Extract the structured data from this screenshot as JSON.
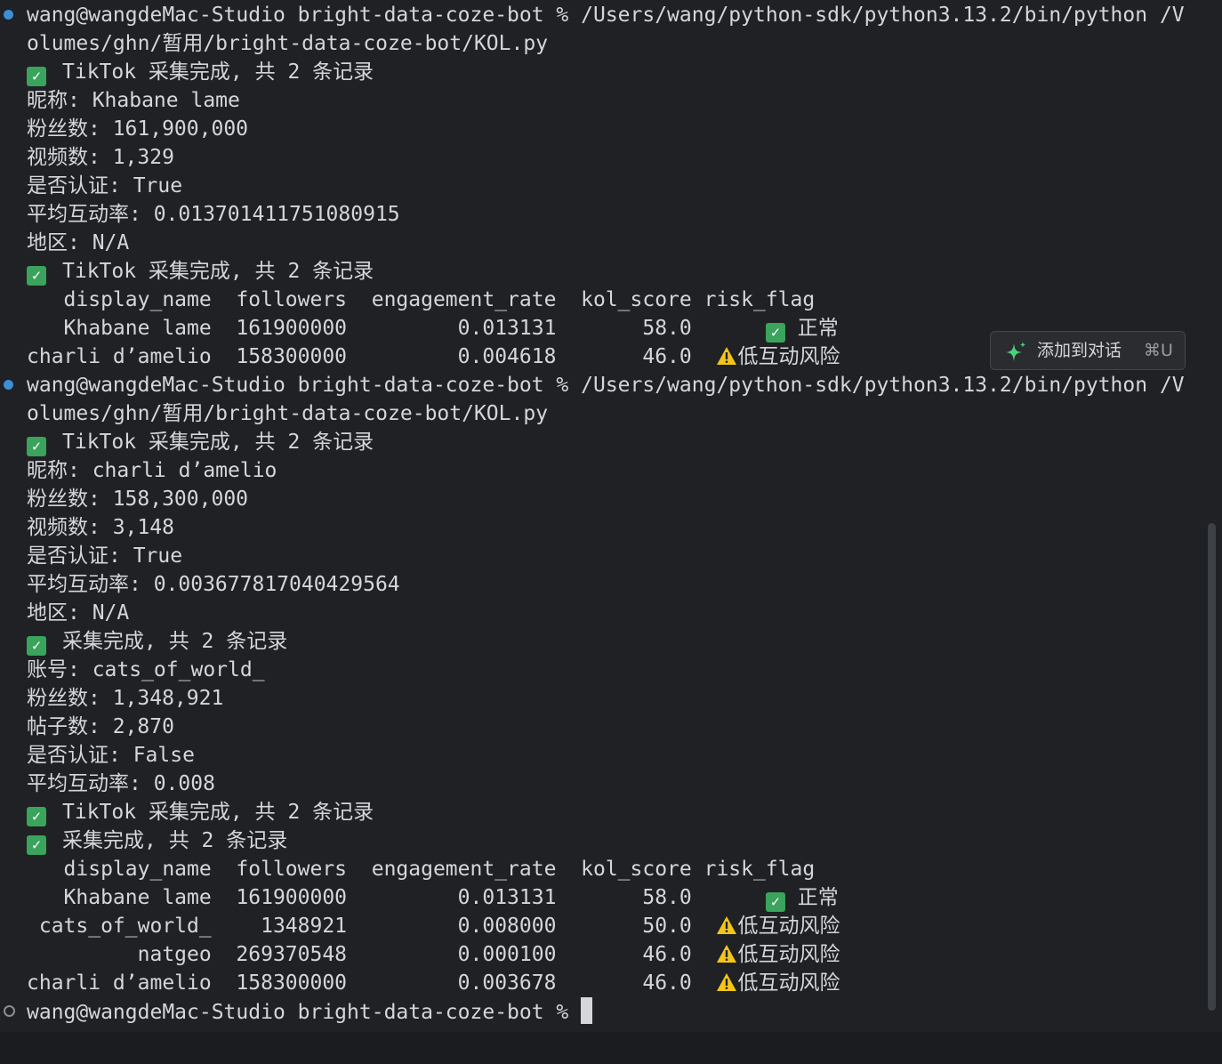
{
  "terminal": {
    "prompt": "wang@wangdeMac-Studio bright-data-coze-bot %",
    "command_part1": " /Users/wang/python-sdk/python3.13.2/bin/python /V",
    "command_part2": "olumes/ghn/暂用/bright-data-coze-bot/KOL.py",
    "tiktok_done": "TikTok 采集完成, 共 2 条记录",
    "ig_done": "采集完成, 共 2 条记录",
    "run1": {
      "nickname": "昵称: Khabane lame",
      "followers": "粉丝数: 161,900,000",
      "videos": "视频数: 1,329",
      "verified": "是否认证: True",
      "engagement": "平均互动率: 0.013701411751080915",
      "region": "地区: N/A",
      "table_header": "   display_name  followers  engagement_rate  kol_score risk_flag",
      "rows": [
        {
          "text": "   Khabane lame  161900000         0.013131       58.0      ",
          "flag_icon": "check",
          "flag": " 正常"
        },
        {
          "text": "charli d’amelio  158300000         0.004618       46.0  ",
          "flag_icon": "warning",
          "flag": "低互动风险"
        }
      ]
    },
    "run2": {
      "nickname": "昵称: charli d’amelio",
      "followers": "粉丝数: 158,300,000",
      "videos": "视频数: 3,148",
      "verified": "是否认证: True",
      "engagement": "平均互动率: 0.003677817040429564",
      "region": "地区: N/A",
      "ig_account": "账号: cats_of_world_",
      "ig_followers": "粉丝数: 1,348,921",
      "ig_posts": "帖子数: 2,870",
      "ig_verified": "是否认证: False",
      "ig_engagement": "平均互动率: 0.008",
      "table_header": "   display_name  followers  engagement_rate  kol_score risk_flag",
      "rows": [
        {
          "text": "   Khabane lame  161900000         0.013131       58.0      ",
          "flag_icon": "check",
          "flag": " 正常"
        },
        {
          "text": " cats_of_world_    1348921         0.008000       50.0  ",
          "flag_icon": "warning",
          "flag": "低互动风险"
        },
        {
          "text": "         natgeo  269370548         0.000100       46.0  ",
          "flag_icon": "warning",
          "flag": "低互动风险"
        },
        {
          "text": "charli d’amelio  158300000         0.003678       46.0  ",
          "flag_icon": "warning",
          "flag": "低互动风险"
        }
      ]
    }
  },
  "popup": {
    "label": "添加到对话",
    "shortcut": "⌘U",
    "icon": "sparkle-icon"
  },
  "colors": {
    "background": "#1f2124",
    "text": "#d4d6da",
    "dot_blue": "#3b8fd6",
    "check_green": "#3aa35c",
    "warning_yellow": "#f5c518",
    "sparkle_green": "#4cd17a"
  }
}
